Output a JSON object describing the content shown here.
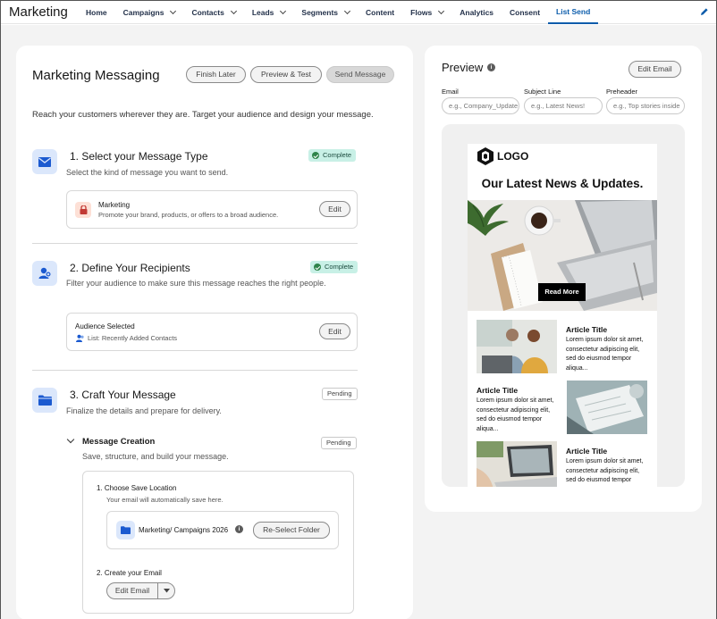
{
  "app": {
    "title": "Marketing"
  },
  "nav": [
    {
      "label": "Home",
      "chevron": false,
      "active": false
    },
    {
      "label": "Campaigns",
      "chevron": true,
      "active": false
    },
    {
      "label": "Contacts",
      "chevron": true,
      "active": false
    },
    {
      "label": "Leads",
      "chevron": true,
      "active": false
    },
    {
      "label": "Segments",
      "chevron": true,
      "active": false
    },
    {
      "label": "Content",
      "chevron": false,
      "active": false
    },
    {
      "label": "Flows",
      "chevron": true,
      "active": false
    },
    {
      "label": "Analytics",
      "chevron": false,
      "active": false
    },
    {
      "label": "Consent",
      "chevron": false,
      "active": false
    },
    {
      "label": "List Send",
      "chevron": false,
      "active": true
    }
  ],
  "main": {
    "title": "Marketing Messaging",
    "buttons": {
      "finish_later": "Finish Later",
      "preview_test": "Preview & Test",
      "send_message": "Send Message"
    },
    "intro": "Reach your customers wherever they are. Target your audience and design your message."
  },
  "step1": {
    "title": "1. Select your Message Type",
    "desc": "Select the kind of message you want to send.",
    "status": "Complete",
    "card_title": "Marketing",
    "card_desc": "Promote your brand, products, or offers to a broad audience.",
    "edit": "Edit"
  },
  "step2": {
    "title": "2. Define Your Recipients",
    "desc": "Filter your audience to make sure this message reaches the right people.",
    "status": "Complete",
    "card_title": "Audience Selected",
    "card_desc": "List: Recently Added Contacts",
    "edit": "Edit"
  },
  "step3": {
    "title": "3. Craft Your Message",
    "desc": "Finalize the details and prepare for delivery.",
    "status": "Pending",
    "section_title": "Message Creation",
    "section_desc": "Save, structure, and build your message.",
    "section_status": "Pending",
    "sub1_title": "1. Choose Save Location",
    "sub1_desc": "Your email will automatically save here.",
    "folder": "Marketing/ Campaigns 2026",
    "reselect": "Re-Select Folder",
    "sub2_title": "2. Create your Email",
    "edit_email": "Edit Email"
  },
  "preview": {
    "title": "Preview",
    "edit_email": "Edit Email",
    "fields": [
      {
        "label": "Email",
        "placeholder": "e.g., Company_Update"
      },
      {
        "label": "Subject Line",
        "placeholder": "e.g., Latest News!"
      },
      {
        "label": "Preheader",
        "placeholder": "e.g., Top stories inside"
      }
    ],
    "email": {
      "logo": "LOGO",
      "headline": "Our Latest News & Updates.",
      "cta": "Read More",
      "articles": [
        {
          "title": "Article Title",
          "body": "Lorem ipsum dolor sit amet, consectetur adipiscing elit, sed do eiusmod tempor aliqua..."
        },
        {
          "title": "Article Title",
          "body": "Lorem ipsum dolor sit amet, consectetur adipiscing elit, sed do eiusmod tempor aliqua..."
        },
        {
          "title": "Article Title",
          "body": "Lorem ipsum dolor sit amet, consectetur adipiscing elit, sed do eiusmod tempor aliqua..."
        }
      ]
    }
  },
  "colors": {
    "brand": "#0b5cab",
    "complete": "#c8f0e6",
    "icon_bg": "#dbe7fb"
  }
}
